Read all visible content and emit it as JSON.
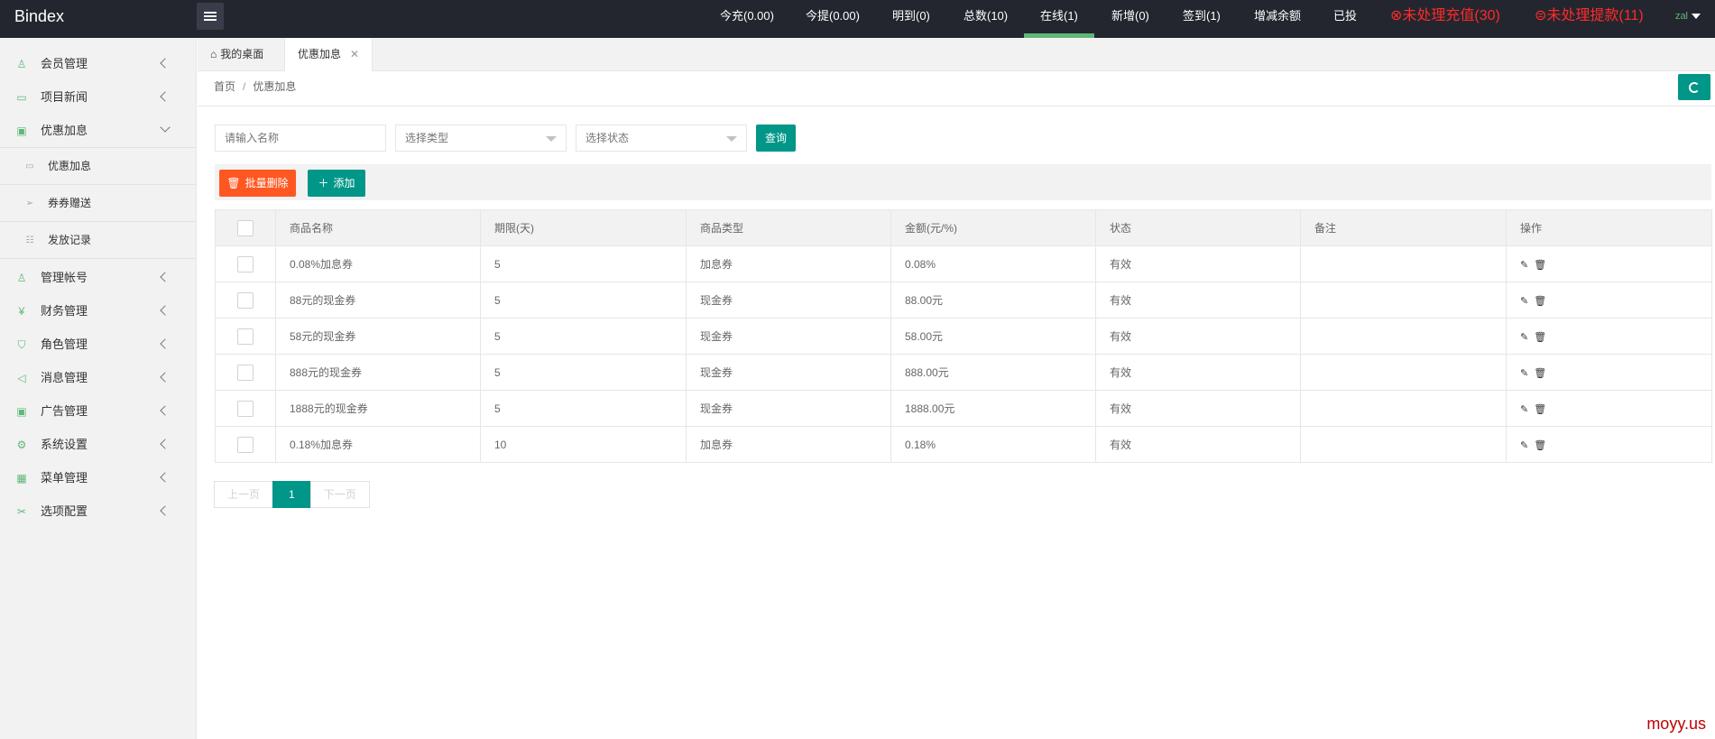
{
  "header": {
    "logo": "Bindex",
    "nav": [
      {
        "label": "今充(0.00)",
        "active": false,
        "alert": false
      },
      {
        "label": "今提(0.00)",
        "active": false,
        "alert": false
      },
      {
        "label": "明到(0)",
        "active": false,
        "alert": false
      },
      {
        "label": "总数(10)",
        "active": false,
        "alert": false
      },
      {
        "label": "在线(1)",
        "active": true,
        "alert": false
      },
      {
        "label": "新增(0)",
        "active": false,
        "alert": false
      },
      {
        "label": "签到(1)",
        "active": false,
        "alert": false
      },
      {
        "label": "增减余额",
        "active": false,
        "alert": false
      },
      {
        "label": "已投",
        "active": false,
        "alert": false
      },
      {
        "label": "⊗未处理充值(30)",
        "active": false,
        "alert": true
      },
      {
        "label": "⊜未处理提款(11)",
        "active": false,
        "alert": true
      }
    ],
    "user": "zal"
  },
  "sidebar": {
    "items": [
      {
        "label": "会员管理",
        "icon": "user-icon"
      },
      {
        "label": "项目新闻",
        "icon": "book-icon"
      },
      {
        "label": "优惠加息",
        "icon": "image-icon",
        "expanded": true
      },
      {
        "label": "管理帐号",
        "icon": "users-icon"
      },
      {
        "label": "财务管理",
        "icon": "yen-icon"
      },
      {
        "label": "角色管理",
        "icon": "shield-icon"
      },
      {
        "label": "消息管理",
        "icon": "speaker-icon"
      },
      {
        "label": "广告管理",
        "icon": "picture-icon"
      },
      {
        "label": "系统设置",
        "icon": "gear-icon"
      },
      {
        "label": "菜单管理",
        "icon": "grid-icon"
      },
      {
        "label": "选项配置",
        "icon": "tools-icon"
      }
    ],
    "submenu": [
      {
        "label": "优惠加息",
        "icon": "book-icon"
      },
      {
        "label": "券券赠送",
        "icon": "send-icon"
      },
      {
        "label": "发放记录",
        "icon": "list-icon"
      }
    ]
  },
  "tabs": [
    {
      "label": "我的桌面",
      "active": false
    },
    {
      "label": "优惠加息",
      "active": true
    }
  ],
  "breadcrumb": {
    "home": "首页",
    "separator": "/",
    "current": "优惠加息"
  },
  "filters": {
    "name_placeholder": "请输入名称",
    "type_select": "选择类型",
    "status_select": "选择状态",
    "search_label": "查询"
  },
  "toolbar": {
    "batch_delete": "批量删除",
    "add": "添加"
  },
  "table": {
    "columns": [
      "商品名称",
      "期限(天)",
      "商品类型",
      "金额(元/%)",
      "状态",
      "备注",
      "操作"
    ],
    "rows": [
      {
        "name": "0.08%加息券",
        "days": "5",
        "type": "加息券",
        "amount": "0.08%",
        "status": "有效",
        "note": ""
      },
      {
        "name": "88元的现金券",
        "days": "5",
        "type": "现金券",
        "amount": "88.00元",
        "status": "有效",
        "note": ""
      },
      {
        "name": "58元的现金券",
        "days": "5",
        "type": "现金券",
        "amount": "58.00元",
        "status": "有效",
        "note": ""
      },
      {
        "name": "888元的现金券",
        "days": "5",
        "type": "现金券",
        "amount": "888.00元",
        "status": "有效",
        "note": ""
      },
      {
        "name": "1888元的现金券",
        "days": "5",
        "type": "现金券",
        "amount": "1888.00元",
        "status": "有效",
        "note": ""
      },
      {
        "name": "0.18%加息券",
        "days": "10",
        "type": "加息券",
        "amount": "0.18%",
        "status": "有效",
        "note": ""
      }
    ]
  },
  "pagination": {
    "prev": "上一页",
    "current": "1",
    "next": "下一页"
  },
  "watermark": "moyy.us",
  "colors": {
    "primary": "#009688",
    "danger": "#ff5722",
    "header": "#23262e",
    "alert": "#ff2a2a",
    "active_indicator": "#5fb878"
  }
}
